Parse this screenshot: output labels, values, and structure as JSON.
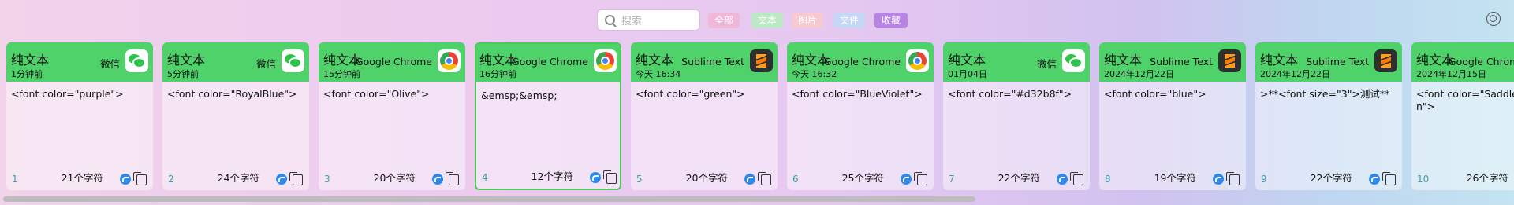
{
  "toolbar": {
    "search_placeholder": "搜索",
    "filters": [
      {
        "label": "全部",
        "color": "#f0b7d9"
      },
      {
        "label": "文本",
        "color": "#bde8c6"
      },
      {
        "label": "图片",
        "color": "#f7c9d2"
      },
      {
        "label": "文件",
        "color": "#c5d7f5"
      },
      {
        "label": "收藏",
        "color": "#b884e3"
      }
    ]
  },
  "cards": [
    {
      "type": "纯文本",
      "time": "1分钟前",
      "app": "微信",
      "icon": "wechat-icon",
      "content": "<font color=\"purple\">",
      "index": "1",
      "count": "21个字符"
    },
    {
      "type": "纯文本",
      "time": "5分钟前",
      "app": "微信",
      "icon": "wechat-icon",
      "content": "<font color=\"RoyalBlue\">",
      "index": "2",
      "count": "24个字符"
    },
    {
      "type": "纯文本",
      "time": "15分钟前",
      "app": "Google Chrome",
      "icon": "chrome-icon",
      "content": "<font color=\"Olive\">",
      "index": "3",
      "count": "20个字符"
    },
    {
      "type": "纯文本",
      "time": "16分钟前",
      "app": "Google Chrome",
      "icon": "chrome-icon",
      "content": "&emsp;&emsp;",
      "index": "4",
      "count": "12个字符",
      "selected": true
    },
    {
      "type": "纯文本",
      "time": "今天 16:34",
      "app": "Sublime Text",
      "icon": "sublime-icon",
      "content": "<font color=\"green\">",
      "index": "5",
      "count": "20个字符"
    },
    {
      "type": "纯文本",
      "time": "今天 16:32",
      "app": "Google Chrome",
      "icon": "chrome-icon",
      "content": "<font color=\"BlueViolet\">",
      "index": "6",
      "count": "25个字符"
    },
    {
      "type": "纯文本",
      "time": "01月04日",
      "app": "微信",
      "icon": "wechat-icon",
      "content": "<font color=\"#d32b8f\">",
      "index": "7",
      "count": "22个字符"
    },
    {
      "type": "纯文本",
      "time": "2024年12月22日",
      "app": "Sublime Text",
      "icon": "sublime-icon",
      "content": "<font color=\"blue\">",
      "index": "8",
      "count": "19个字符"
    },
    {
      "type": "纯文本",
      "time": "2024年12月22日",
      "app": "Sublime Text",
      "icon": "sublime-icon",
      "content": ">**<font size=\"3\">测试**",
      "index": "9",
      "count": "22个字符"
    },
    {
      "type": "纯文本",
      "time": "2024年12月15日",
      "app": "Google Chrome",
      "icon": "chrome-icon",
      "content": "<font color=\"SaddleBrown\">",
      "index": "10",
      "count": "26个字符"
    }
  ]
}
